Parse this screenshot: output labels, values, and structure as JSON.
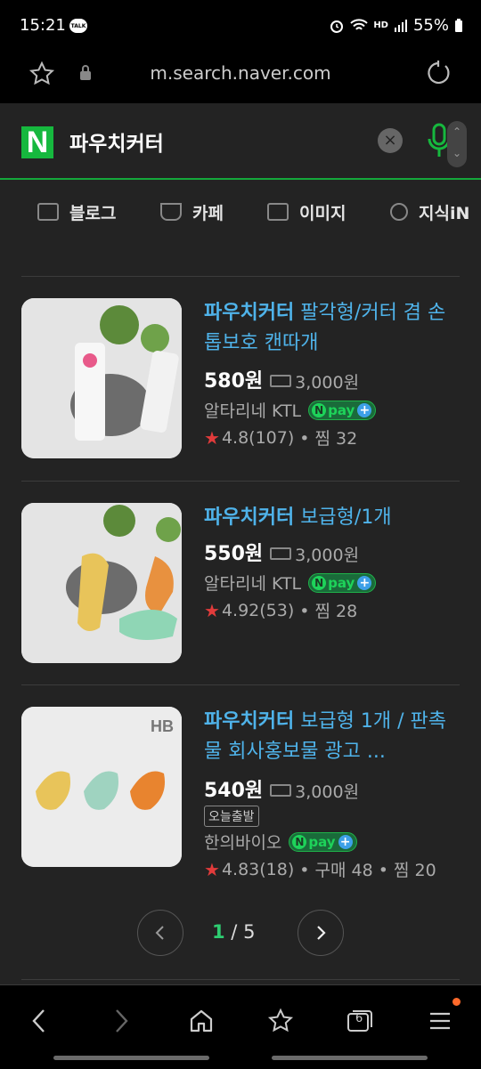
{
  "status_bar": {
    "time": "15:21",
    "talk_badge": "TALK",
    "hd_label": "HD",
    "battery": "55%"
  },
  "url_bar": {
    "url": "m.search.naver.com"
  },
  "search": {
    "logo": "N",
    "query": "파우치커터",
    "clear_symbol": "×"
  },
  "tabs": [
    {
      "label": "블로그",
      "icon": "blog-icon"
    },
    {
      "label": "카페",
      "icon": "cafe-icon"
    },
    {
      "label": "이미지",
      "icon": "image-icon"
    },
    {
      "label": "지식iN",
      "icon": "knowledge-search-icon"
    }
  ],
  "products": [
    {
      "title_bold": "파우치커터",
      "title_rest": " 팔각형/커터 겸 손톱보호 캔따개",
      "price": "580원",
      "shipping": "3,000원",
      "badge": "",
      "seller": "알타리네 KTL",
      "rating": "4.8",
      "reviews": "(107)",
      "stats": "• 찜 32"
    },
    {
      "title_bold": "파우치커터",
      "title_rest": " 보급형/1개",
      "price": "550원",
      "shipping": "3,000원",
      "badge": "",
      "seller": "알타리네 KTL",
      "rating": "4.92",
      "reviews": "(53)",
      "stats": "• 찜 28"
    },
    {
      "title_bold": "파우치커터",
      "title_rest": " 보급형 1개 / 판촉물 회사홍보물 광고 ...",
      "price": "540원",
      "shipping": "3,000원",
      "badge": "오늘출발",
      "seller": "한의바이오",
      "rating": "4.83",
      "reviews": "(18)",
      "stats": "• 구매 48 • 찜 20"
    }
  ],
  "npay": {
    "label": "pay",
    "n": "N",
    "plus": "+"
  },
  "thumb3_brand": "HB",
  "pager": {
    "current": "1",
    "separator": " / ",
    "total": "5"
  },
  "bottom_nav": {
    "tabs_count": "6"
  },
  "colors": {
    "accent_green": "#16b83e",
    "link_blue": "#4fb3ea",
    "star_red": "#e23b3b",
    "background": "#232323"
  }
}
